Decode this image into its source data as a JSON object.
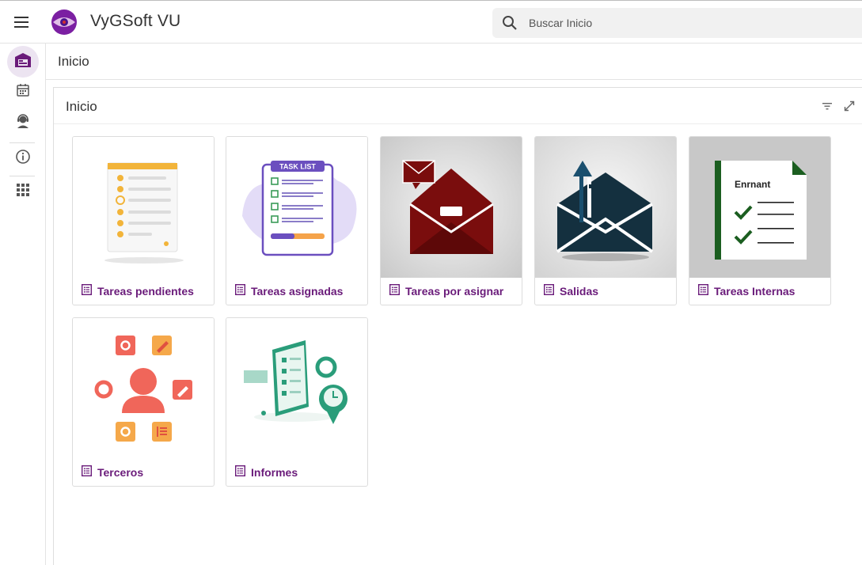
{
  "app": {
    "title": "VyGSoft VU"
  },
  "search": {
    "placeholder": "Buscar Inicio"
  },
  "page": {
    "title": "Inicio"
  },
  "panel": {
    "title": "Inicio"
  },
  "colors": {
    "accent": "#6a1b7a",
    "rail_active_bg": "#ece4f1",
    "maroon": "#7a0d0d",
    "navy": "#14303f",
    "green": "#1b5e20"
  },
  "rail": [
    {
      "icon": "warehouse-icon",
      "active": true
    },
    {
      "icon": "calendar-icon"
    },
    {
      "icon": "support-agent-icon"
    },
    {
      "icon": "info-icon"
    },
    {
      "icon": "apps-grid-icon"
    }
  ],
  "tiles": [
    {
      "label": "Tareas pendientes"
    },
    {
      "label": "Tareas asignadas",
      "image_text": "TASK LIST"
    },
    {
      "label": "Tareas por asignar"
    },
    {
      "label": "Salidas"
    },
    {
      "label": "Tareas Internas",
      "image_text": "Enrnant"
    },
    {
      "label": "Terceros"
    },
    {
      "label": "Informes"
    }
  ]
}
